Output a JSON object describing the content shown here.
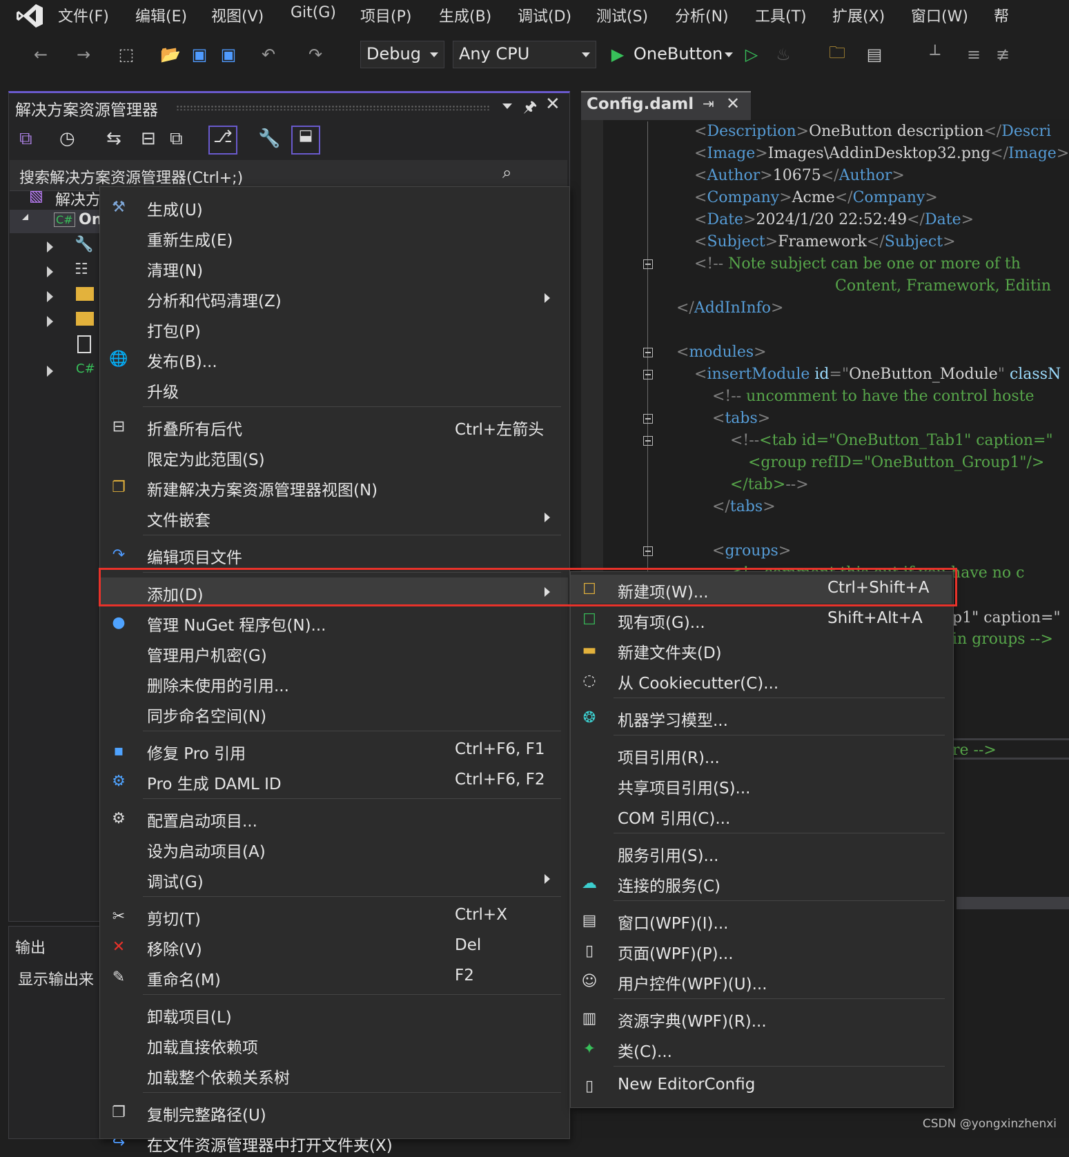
{
  "menubar": {
    "items": [
      "文件(F)",
      "编辑(E)",
      "视图(V)",
      "Git(G)",
      "项目(P)",
      "生成(B)",
      "调试(D)",
      "测试(S)",
      "分析(N)",
      "工具(T)",
      "扩展(X)",
      "窗口(W)",
      "帮"
    ]
  },
  "toolbar": {
    "config": "Debug",
    "platform": "Any CPU",
    "start_project": "OneButton"
  },
  "solution_explorer": {
    "title": "解决方案资源管理器",
    "search_placeholder": "搜索解决方案资源管理器(Ctrl+;)",
    "solution_row": "解决方",
    "project_row": "On",
    "csharp_label": "C#"
  },
  "output": {
    "title": "输出",
    "source_label": "显示输出来"
  },
  "editor": {
    "tab_title": "Config.daml",
    "lines": [
      {
        "parts": [
          [
            "b",
            "<"
          ],
          [
            "t",
            "Description"
          ],
          [
            "b",
            ">"
          ],
          [
            "x",
            "OneButton description"
          ],
          [
            "b",
            "</"
          ],
          [
            "t",
            "Descri"
          ]
        ]
      },
      {
        "parts": [
          [
            "b",
            "<"
          ],
          [
            "t",
            "Image"
          ],
          [
            "b",
            ">"
          ],
          [
            "x",
            "Images\\AddinDesktop32.png"
          ],
          [
            "b",
            "</"
          ],
          [
            "t",
            "Image"
          ],
          [
            "b",
            ">"
          ]
        ]
      },
      {
        "parts": [
          [
            "b",
            "<"
          ],
          [
            "t",
            "Author"
          ],
          [
            "b",
            ">"
          ],
          [
            "x",
            "10675"
          ],
          [
            "b",
            "</"
          ],
          [
            "t",
            "Author"
          ],
          [
            "b",
            ">"
          ]
        ]
      },
      {
        "parts": [
          [
            "b",
            "<"
          ],
          [
            "t",
            "Company"
          ],
          [
            "b",
            ">"
          ],
          [
            "x",
            "Acme"
          ],
          [
            "b",
            "</"
          ],
          [
            "t",
            "Company"
          ],
          [
            "b",
            ">"
          ]
        ]
      },
      {
        "parts": [
          [
            "b",
            "<"
          ],
          [
            "t",
            "Date"
          ],
          [
            "b",
            ">"
          ],
          [
            "x",
            "2024/1/20 22:52:49"
          ],
          [
            "b",
            "</"
          ],
          [
            "t",
            "Date"
          ],
          [
            "b",
            ">"
          ]
        ]
      },
      {
        "parts": [
          [
            "b",
            "<"
          ],
          [
            "t",
            "Subject"
          ],
          [
            "b",
            ">"
          ],
          [
            "x",
            "Framework"
          ],
          [
            "b",
            "</"
          ],
          [
            "t",
            "Subject"
          ],
          [
            "b",
            ">"
          ]
        ]
      },
      {
        "parts": [
          [
            "b",
            "<!-- "
          ],
          [
            "c",
            "Note subject can be one or more of th"
          ]
        ]
      },
      {
        "parts": [
          [
            "c",
            "Content, Framework, Editin"
          ]
        ]
      },
      {
        "parts": [
          [
            "b",
            "</"
          ],
          [
            "t",
            "AddInInfo"
          ],
          [
            "b",
            ">"
          ]
        ]
      },
      {
        "parts": []
      },
      {
        "parts": [
          [
            "b",
            "<"
          ],
          [
            "t",
            "modules"
          ],
          [
            "b",
            ">"
          ]
        ]
      },
      {
        "parts": [
          [
            "b",
            "<"
          ],
          [
            "t",
            "insertModule"
          ],
          [
            "x",
            " "
          ],
          [
            "a",
            "id"
          ],
          [
            "b",
            "=\""
          ],
          [
            "x",
            "OneButton_Module"
          ],
          [
            "b",
            "\""
          ],
          [
            "x",
            " "
          ],
          [
            "a",
            "classN"
          ]
        ]
      },
      {
        "parts": [
          [
            "b",
            "<!-- "
          ],
          [
            "c",
            "uncomment to have the control hoste"
          ]
        ]
      },
      {
        "parts": [
          [
            "b",
            "<"
          ],
          [
            "t",
            "tabs"
          ],
          [
            "b",
            ">"
          ]
        ]
      },
      {
        "parts": [
          [
            "b",
            "<!--"
          ],
          [
            "c",
            "<tab id=\"OneButton_Tab1\" caption=\""
          ]
        ]
      },
      {
        "parts": [
          [
            "c",
            "<group refID=\"OneButton_Group1\"/>"
          ]
        ]
      },
      {
        "parts": [
          [
            "c",
            "</tab>"
          ],
          [
            "b",
            "-->"
          ]
        ]
      },
      {
        "parts": [
          [
            "b",
            "</"
          ],
          [
            "t",
            "tabs"
          ],
          [
            "b",
            ">"
          ]
        ]
      },
      {
        "parts": []
      },
      {
        "parts": [
          [
            "b",
            "<"
          ],
          [
            "t",
            "groups"
          ],
          [
            "b",
            ">"
          ]
        ]
      },
      {
        "parts": [
          [
            "c",
            "<!-- comment this out if you have no c"
          ]
        ]
      }
    ],
    "peek_lines": [
      "p1\" caption=\"",
      "in groups -->",
      "re -->"
    ]
  },
  "context_menu": {
    "items": [
      {
        "label": "生成(U)",
        "icon": "build-icon"
      },
      {
        "label": "重新生成(E)"
      },
      {
        "label": "清理(N)"
      },
      {
        "label": "分析和代码清理(Z)",
        "submenu": true
      },
      {
        "label": "打包(P)"
      },
      {
        "label": "发布(B)...",
        "icon": "publish-globe-icon"
      },
      {
        "label": "升级"
      },
      {
        "label": "折叠所有后代",
        "shortcut": "Ctrl+左箭头",
        "icon": "collapse-icon"
      },
      {
        "label": "限定为此范围(S)"
      },
      {
        "label": "新建解决方案资源管理器视图(N)",
        "icon": "new-view-icon"
      },
      {
        "label": "文件嵌套",
        "submenu": true
      },
      {
        "label": "编辑项目文件",
        "icon": "edit-project-icon"
      },
      {
        "label": "添加(D)",
        "submenu": true,
        "highlighted": true
      },
      {
        "label": "管理 NuGet 程序包(N)...",
        "icon": "nuget-icon"
      },
      {
        "label": "管理用户机密(G)"
      },
      {
        "label": "删除未使用的引用..."
      },
      {
        "label": "同步命名空间(N)"
      },
      {
        "label": "修复 Pro 引用",
        "shortcut": "Ctrl+F6, F1",
        "icon": "fix-reference-icon"
      },
      {
        "label": "Pro 生成 DAML ID",
        "shortcut": "Ctrl+F6, F2",
        "icon": "gear-blue-icon"
      },
      {
        "label": "配置启动项目...",
        "icon": "gear-icon"
      },
      {
        "label": "设为启动项目(A)"
      },
      {
        "label": "调试(G)",
        "submenu": true
      },
      {
        "label": "剪切(T)",
        "shortcut": "Ctrl+X",
        "icon": "scissors-icon"
      },
      {
        "label": "移除(V)",
        "shortcut": "Del",
        "icon": "remove-x-icon"
      },
      {
        "label": "重命名(M)",
        "shortcut": "F2",
        "icon": "rename-icon"
      },
      {
        "label": "卸载项目(L)"
      },
      {
        "label": "加载直接依赖项"
      },
      {
        "label": "加载整个依赖关系树"
      },
      {
        "label": "复制完整路径(U)",
        "icon": "copy-icon"
      },
      {
        "label": "在文件资源管理器中打开文件夹(X)",
        "icon": "folder-open-icon"
      }
    ]
  },
  "add_submenu": {
    "items": [
      {
        "label": "新建项(W)...",
        "shortcut": "Ctrl+Shift+A",
        "icon": "new-item-icon",
        "highlighted": true
      },
      {
        "label": "现有项(G)...",
        "shortcut": "Shift+Alt+A",
        "icon": "existing-item-icon"
      },
      {
        "label": "新建文件夹(D)",
        "icon": "new-folder-icon"
      },
      {
        "label": "从 Cookiecutter(C)...",
        "icon": "cookiecutter-icon"
      },
      {
        "label": "机器学习模型...",
        "icon": "ml-model-icon"
      },
      {
        "label": "项目引用(R)..."
      },
      {
        "label": "共享项目引用(S)..."
      },
      {
        "label": "COM 引用(C)..."
      },
      {
        "label": "服务引用(S)..."
      },
      {
        "label": "连接的服务(C)",
        "icon": "connected-service-icon"
      },
      {
        "label": "窗口(WPF)(I)...",
        "icon": "wpf-window-icon"
      },
      {
        "label": "页面(WPF)(P)...",
        "icon": "wpf-page-icon"
      },
      {
        "label": "用户控件(WPF)(U)...",
        "icon": "user-control-icon"
      },
      {
        "label": "资源字典(WPF)(R)...",
        "icon": "resource-dictionary-icon"
      },
      {
        "label": "类(C)...",
        "icon": "class-icon"
      },
      {
        "label": "New EditorConfig",
        "icon": "editorconfig-icon"
      }
    ]
  },
  "watermark": "CSDN @yongxinzhenxi",
  "colors": {
    "accent": "#6a5acd",
    "highlight_border": "#e8322a",
    "menu_bg": "#2c2c2c"
  }
}
